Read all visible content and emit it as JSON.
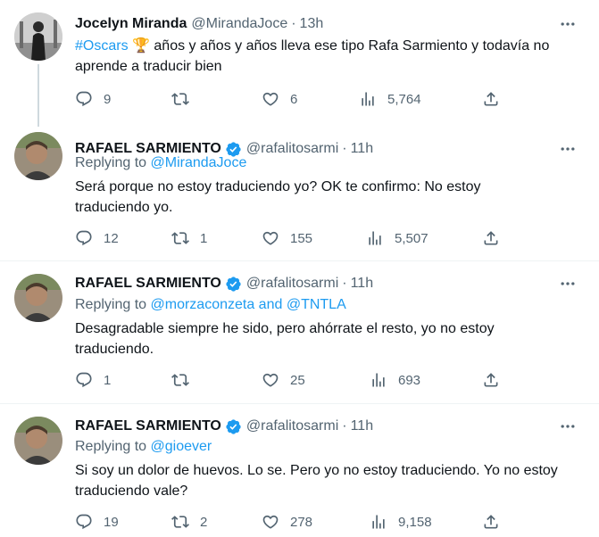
{
  "tweets": [
    {
      "name": "Jocelyn Miranda",
      "verified": false,
      "handle": "@MirandaJoce",
      "dot": "·",
      "time": "13h",
      "replying_label": "",
      "replying_to": "",
      "hashtag": "#Oscars",
      "emoji": "🏆",
      "text": "años y años y años lleva ese tipo Rafa Sarmiento y todavía no aprende a traducir bien",
      "replies": "9",
      "retweets": "",
      "likes": "6",
      "views": "5,764"
    },
    {
      "name": "RAFAEL SARMIENTO",
      "verified": true,
      "handle": "@rafalitosarmi",
      "dot": "·",
      "time": "11h",
      "replying_label": "Replying to",
      "replying_to": "@MirandaJoce",
      "text": "Será porque no estoy traduciendo yo? OK te confirmo: No estoy traduciendo yo.",
      "replies": "12",
      "retweets": "1",
      "likes": "155",
      "views": "5,507"
    },
    {
      "name": "RAFAEL SARMIENTO",
      "verified": true,
      "handle": "@rafalitosarmi",
      "dot": "·",
      "time": "11h",
      "replying_label": "Replying to",
      "replying_to": "@morzaconzeta and @TNTLA",
      "text": "Desagradable siempre he sido, pero ahórrate el resto, yo no estoy traduciendo.",
      "replies": "1",
      "retweets": "",
      "likes": "25",
      "views": "693"
    },
    {
      "name": "RAFAEL SARMIENTO",
      "verified": true,
      "handle": "@rafalitosarmi",
      "dot": "·",
      "time": "11h",
      "replying_label": "Replying to",
      "replying_to": "@gioever",
      "text": "Si soy un dolor de huevos. Lo se. Pero yo no estoy traduciendo. Yo no estoy traduciendo vale?",
      "replies": "19",
      "retweets": "2",
      "likes": "278",
      "views": "9,158"
    }
  ],
  "colors": {
    "accent": "#1d9bf0",
    "muted": "#536471",
    "text": "#0f1419",
    "divider": "#eff3f4",
    "thread_line": "#cfd9de"
  },
  "icons": {
    "reply": "reply-icon",
    "retweet": "retweet-icon",
    "like": "heart-icon",
    "views": "views-icon",
    "share": "share-icon",
    "more": "more-icon",
    "verified": "verified-badge-icon"
  }
}
